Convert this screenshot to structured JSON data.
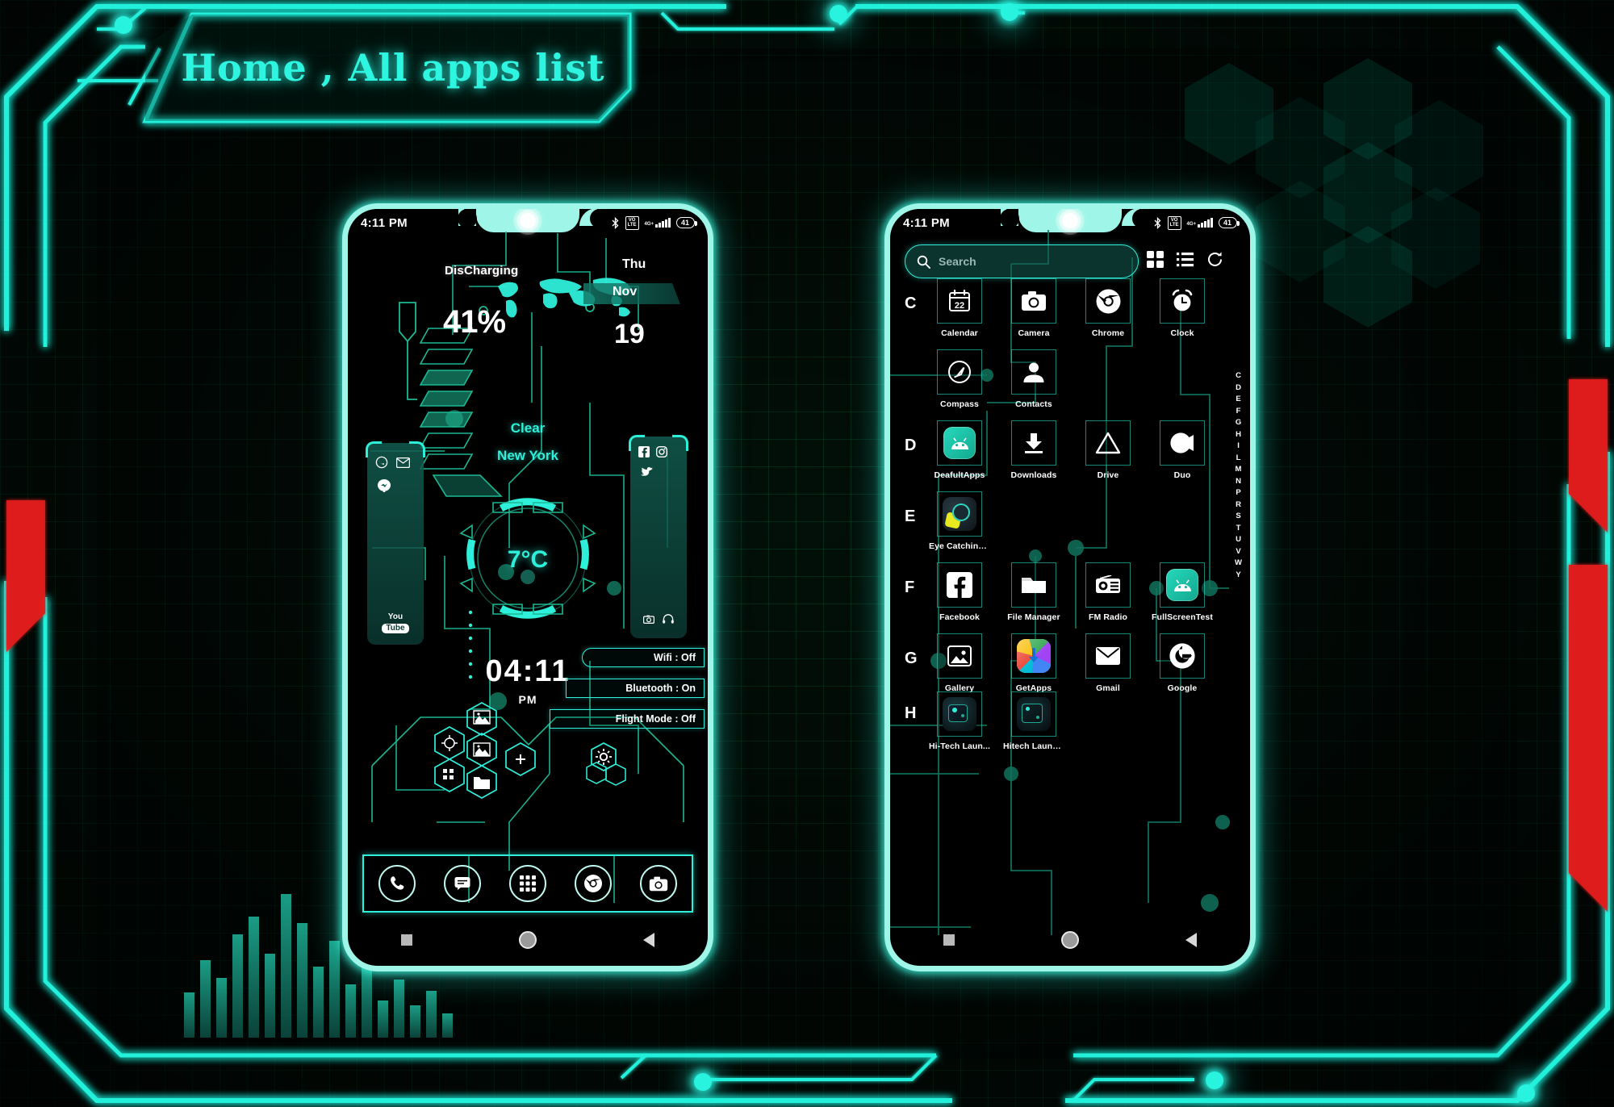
{
  "page": {
    "title": "Home , All apps list",
    "theme": {
      "accent": "#2ef0da",
      "neon": "#27f3df",
      "red": "#e01b1b",
      "bg": "#021009"
    }
  },
  "left_phone": {
    "name": "home-screen-preview",
    "status_bar": {
      "time": "4:11 PM",
      "icons": [
        "bluetooth-icon",
        "volte-icon",
        "signal-4gplus-icon",
        "battery-icon"
      ],
      "network_label": "4G+",
      "volte_label_top": "VO",
      "volte_label_bottom": "LTE",
      "battery_level": "41"
    },
    "battery_widget": {
      "status": "DisCharging",
      "percent": "41%"
    },
    "date_widget": {
      "weekday": "Thu",
      "month": "Nov",
      "day": "19"
    },
    "weather_widget": {
      "condition": "Clear",
      "city": "New York",
      "temperature": "7°C"
    },
    "clock_widget": {
      "time": "04:11",
      "meridiem": "PM"
    },
    "toggles": [
      {
        "label": "Wifi : Off"
      },
      {
        "label": "Bluetooth : On"
      },
      {
        "label": "Flight Mode : Off"
      }
    ],
    "left_shortcut_panel": {
      "icons": [
        "whatsapp-icon",
        "gmail-icon",
        "messenger-icon"
      ],
      "bottom_label_top": "You",
      "bottom_label_bottom": "Tube"
    },
    "right_shortcut_panel": {
      "icons": [
        "facebook-icon",
        "instagram-icon",
        "twitter-icon",
        "camera-small-icon",
        "headphones-icon"
      ]
    },
    "hex_shortcuts": [
      "photos-icon",
      "settings-gear-icon",
      "gallery-icon",
      "app-icon",
      "folder-icon",
      "plus-icon"
    ],
    "floating_gear": "settings-gear-icon",
    "dock": [
      {
        "name": "phone-icon",
        "label": "Phone"
      },
      {
        "name": "messages-icon",
        "label": "Messages"
      },
      {
        "name": "app-drawer-icon",
        "label": "All apps"
      },
      {
        "name": "chrome-icon",
        "label": "Chrome"
      },
      {
        "name": "camera-icon",
        "label": "Camera"
      }
    ],
    "navbar": [
      "recents-button",
      "home-button",
      "back-button"
    ]
  },
  "right_phone": {
    "name": "all-apps-drawer",
    "status_bar": {
      "time": "4:11 PM",
      "network_label": "4G+",
      "volte_label_top": "VO",
      "volte_label_bottom": "LTE",
      "battery_level": "41"
    },
    "search": {
      "placeholder": "Search",
      "icon": "search-icon"
    },
    "drawer_actions": [
      {
        "name": "grid-view-button",
        "icon": "grid-view-icon"
      },
      {
        "name": "list-view-button",
        "icon": "list-view-icon"
      },
      {
        "name": "refresh-button",
        "icon": "refresh-icon"
      }
    ],
    "sections": [
      {
        "letter": "C",
        "apps": [
          {
            "label": "Calendar",
            "icon": "calendar-icon",
            "badge": "22"
          },
          {
            "label": "Camera",
            "icon": "camera-icon"
          },
          {
            "label": "Chrome",
            "icon": "chrome-icon"
          },
          {
            "label": "Clock",
            "icon": "alarm-clock-icon"
          },
          {
            "label": "Compass",
            "icon": "compass-icon"
          },
          {
            "label": "Contacts",
            "icon": "contacts-icon"
          }
        ]
      },
      {
        "letter": "D",
        "apps": [
          {
            "label": "DeafultApps",
            "icon": "android-icon"
          },
          {
            "label": "Downloads",
            "icon": "download-icon"
          },
          {
            "label": "Drive",
            "icon": "drive-icon"
          },
          {
            "label": "Duo",
            "icon": "duo-icon"
          }
        ]
      },
      {
        "letter": "E",
        "apps": [
          {
            "label": "Eye Catching ...",
            "icon": "eye-catching-app-icon"
          }
        ]
      },
      {
        "letter": "F",
        "apps": [
          {
            "label": "Facebook",
            "icon": "facebook-icon"
          },
          {
            "label": "File Manager",
            "icon": "folder-icon"
          },
          {
            "label": "FM Radio",
            "icon": "radio-icon"
          },
          {
            "label": "FullScreenTest",
            "icon": "android-icon"
          }
        ]
      },
      {
        "letter": "G",
        "apps": [
          {
            "label": "Gallery",
            "icon": "gallery-icon"
          },
          {
            "label": "GetApps",
            "icon": "getapps-icon"
          },
          {
            "label": "Gmail",
            "icon": "gmail-icon"
          },
          {
            "label": "Google",
            "icon": "google-g-icon"
          }
        ]
      },
      {
        "letter": "H",
        "apps": [
          {
            "label": "Hi-Tech Laun...",
            "icon": "hitech-launcher-icon"
          },
          {
            "label": "Hitech Launc...",
            "icon": "hitech-launcher-icon"
          }
        ]
      }
    ],
    "az_index": [
      "C",
      "D",
      "E",
      "F",
      "G",
      "H",
      "I",
      "L",
      "M",
      "N",
      "P",
      "R",
      "S",
      "T",
      "U",
      "V",
      "W",
      "Y"
    ],
    "navbar": [
      "recents-button",
      "home-button",
      "back-button"
    ]
  }
}
